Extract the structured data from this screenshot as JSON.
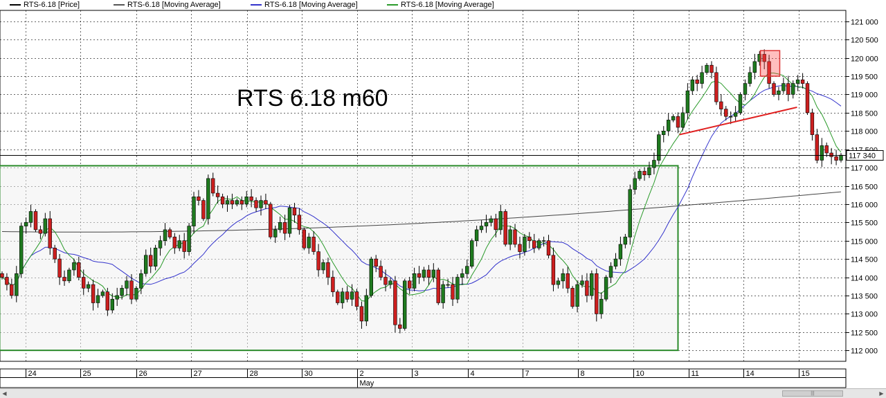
{
  "legend": [
    {
      "label": "RTS-6.18 [Price]",
      "color": "#000000"
    },
    {
      "label": "RTS-6.18 [Moving Average]",
      "color": "#555555"
    },
    {
      "label": "RTS-6.18 [Moving Average]",
      "color": "#3333cc"
    },
    {
      "label": "RTS-6.18 [Moving Average]",
      "color": "#2a9a2a"
    }
  ],
  "chart_data": {
    "type": "candlestick",
    "title": "RTS 6.18 m60",
    "ylim": [
      111700,
      121300
    ],
    "y_ticks": [
      "112 000",
      "112 500",
      "113 000",
      "113 500",
      "114 000",
      "114 500",
      "115 000",
      "115 500",
      "116 000",
      "116 500",
      "117 000",
      "117 500",
      "118 000",
      "118 500",
      "119 000",
      "119 500",
      "120 000",
      "120 500",
      "121 000"
    ],
    "last_price_label": "117 340",
    "last_price": 117340,
    "date_labels": [
      "24",
      "25",
      "26",
      "27",
      "28",
      "30",
      "2",
      "3",
      "4",
      "7",
      "8",
      "10",
      "11",
      "14",
      "15"
    ],
    "month_label": "May",
    "month_label_day": "2",
    "grid": true,
    "series_close": [
      114000,
      113800,
      113500,
      114100,
      115400,
      115500,
      115800,
      115300,
      115200,
      115600,
      114800,
      114500,
      114000,
      113900,
      114200,
      114400,
      114000,
      113700,
      113800,
      113300,
      113500,
      113600,
      113100,
      113400,
      113500,
      113700,
      113900,
      113400,
      113700,
      114100,
      114600,
      114300,
      114800,
      115000,
      115300,
      115100,
      114800,
      115000,
      114700,
      115400,
      116200,
      116100,
      115600,
      116700,
      116300,
      116200,
      116000,
      116100,
      116000,
      116100,
      116000,
      116200,
      116100,
      115900,
      116100,
      116000,
      115100,
      115300,
      115500,
      115200,
      115900,
      115700,
      115300,
      114800,
      115100,
      114700,
      114200,
      114400,
      114000,
      113600,
      113300,
      113600,
      113400,
      113600,
      113200,
      112800,
      113500,
      114500,
      114300,
      114000,
      113800,
      113900,
      112700,
      112600,
      113900,
      113700,
      114100,
      114000,
      114200,
      114000,
      114200,
      113300,
      113800,
      113800,
      113400,
      114000,
      114100,
      114300,
      115000,
      115300,
      115400,
      115500,
      115600,
      115300,
      115800,
      114900,
      115300,
      114900,
      114700,
      115100,
      115000,
      114800,
      115000,
      115000,
      114600,
      113800,
      113900,
      114100,
      113700,
      113200,
      113800,
      113900,
      113500,
      114100,
      113000,
      113400,
      114000,
      114300,
      114500,
      114900,
      115100,
      116400,
      116700,
      116900,
      116800,
      117000,
      117200,
      117900,
      118000,
      118300,
      118400,
      118100,
      118500,
      119100,
      119400,
      119300,
      119600,
      119800,
      119600,
      118800,
      118600,
      118400,
      118400,
      118500,
      119000,
      119300,
      119600,
      119900,
      120100,
      119900,
      119300,
      119000,
      119100,
      119300,
      119000,
      119300,
      119400,
      119300,
      118500,
      117900,
      117200,
      117600,
      117400,
      117300,
      117200,
      117340
    ],
    "ma_long_start": 115250,
    "ma_long_end": 116300,
    "annotations": [
      {
        "type": "rectangle",
        "color": "#2a8a2a",
        "from_day": "24",
        "to_day": "11",
        "y_from": 112000,
        "y_to": 117050
      },
      {
        "type": "rectangle",
        "color": "#dd3333",
        "near_day": "14",
        "y_from": 119500,
        "y_to": 120200
      },
      {
        "type": "trendline",
        "color": "#e02020",
        "from_day": "10",
        "to_day": "15",
        "y_from": 117900,
        "y_to": 118650
      }
    ]
  }
}
